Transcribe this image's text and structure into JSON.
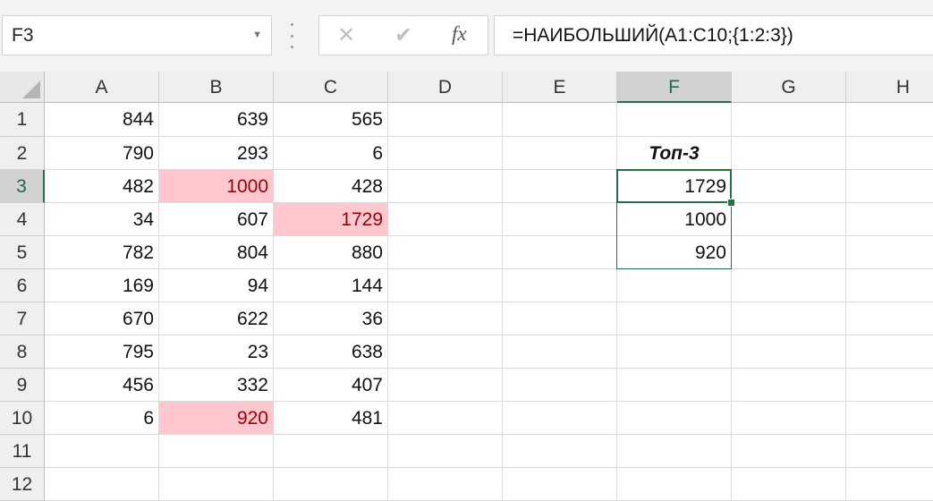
{
  "formula_bar": {
    "name_box": "F3",
    "formula": "=НАИБОЛЬШИЙ(A1:C10;{1:2:3})",
    "cancel_icon": "close-icon",
    "enter_icon": "check-icon",
    "fx_label": "fx"
  },
  "columns": [
    "A",
    "B",
    "C",
    "D",
    "E",
    "F",
    "G",
    "H"
  ],
  "rows": [
    "1",
    "2",
    "3",
    "4",
    "5",
    "6",
    "7",
    "8",
    "9",
    "10",
    "11",
    "12"
  ],
  "active_cell": "F3",
  "colors": {
    "highlight_fill": "#ffc7ce",
    "highlight_text": "#9c0006",
    "selection": "#217346"
  },
  "cells": {
    "A1": "844",
    "B1": "639",
    "C1": "565",
    "A2": "790",
    "B2": "293",
    "C2": "6",
    "F2": "Топ-3",
    "A3": "482",
    "B3": "1000",
    "C3": "428",
    "F3": "1729",
    "A4": "34",
    "B4": "607",
    "C4": "1729",
    "F4": "1000",
    "A5": "782",
    "B5": "804",
    "C5": "880",
    "F5": "920",
    "A6": "169",
    "B6": "94",
    "C6": "144",
    "A7": "670",
    "B7": "622",
    "C7": "36",
    "A8": "795",
    "B8": "23",
    "C8": "638",
    "A9": "456",
    "B9": "332",
    "C9": "407",
    "A10": "6",
    "B10": "920",
    "C10": "481"
  },
  "highlighted_cells": [
    "B3",
    "C4",
    "B10"
  ]
}
